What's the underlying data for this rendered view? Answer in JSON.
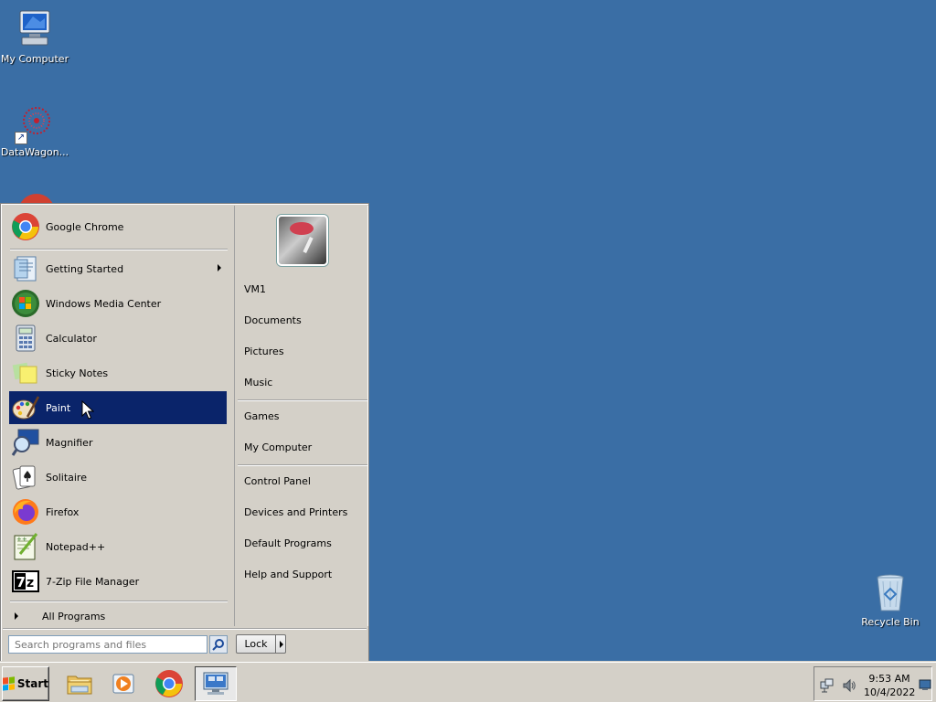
{
  "desktop": {
    "icons": [
      {
        "label": "My Computer"
      },
      {
        "label": "DataWagon..."
      },
      {
        "label": "Recycle Bin"
      }
    ]
  },
  "start_menu": {
    "pinned": [
      {
        "label": "Google Chrome",
        "icon": "chrome-icon"
      }
    ],
    "recent": [
      {
        "label": "Getting Started",
        "icon": "getting-started-icon",
        "submenu": true
      },
      {
        "label": "Windows Media Center",
        "icon": "media-center-icon"
      },
      {
        "label": "Calculator",
        "icon": "calculator-icon"
      },
      {
        "label": "Sticky Notes",
        "icon": "sticky-notes-icon"
      },
      {
        "label": "Paint",
        "icon": "paint-icon",
        "selected": true
      },
      {
        "label": "Magnifier",
        "icon": "magnifier-icon"
      },
      {
        "label": "Solitaire",
        "icon": "solitaire-icon"
      },
      {
        "label": "Firefox",
        "icon": "firefox-icon"
      },
      {
        "label": "Notepad++",
        "icon": "notepadpp-icon"
      },
      {
        "label": "7-Zip File Manager",
        "icon": "7zip-icon"
      }
    ],
    "all_programs": "All Programs",
    "search_placeholder": "Search programs and files",
    "right": {
      "user": "VM1",
      "group1": [
        "Documents",
        "Pictures",
        "Music"
      ],
      "group2": [
        "Games",
        "My Computer"
      ],
      "group3": [
        "Control Panel",
        "Devices and Printers",
        "Default Programs",
        "Help and Support"
      ]
    },
    "lock_label": "Lock"
  },
  "taskbar": {
    "start_label": "Start",
    "pinned": [
      "file-explorer-icon",
      "media-player-icon",
      "chrome-icon",
      "remote-desktop-icon"
    ],
    "time": "9:53 AM",
    "date": "10/4/2022"
  },
  "colors": {
    "desktop": "#3a6ea5",
    "menu": "#d4d0c8",
    "selection": "#0a246a"
  }
}
